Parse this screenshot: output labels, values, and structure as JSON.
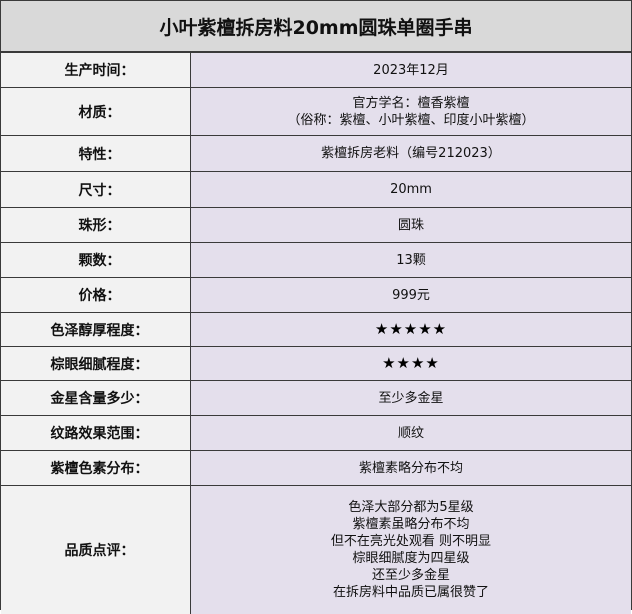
{
  "title": "小叶紫檀拆房料20mm圆珠单圈手串",
  "rows": [
    {
      "label": "生产时间：",
      "lines": [
        "2023年12月"
      ]
    },
    {
      "label": "材质：",
      "lines": [
        "官方学名：檀香紫檀",
        "（俗称：紫檀、小叶紫檀、印度小叶紫檀）"
      ]
    },
    {
      "label": "特性：",
      "lines": [
        "紫檀拆房老料（编号212023）"
      ]
    },
    {
      "label": "尺寸：",
      "lines": [
        "20mm"
      ]
    },
    {
      "label": "珠形：",
      "lines": [
        "圆珠"
      ]
    },
    {
      "label": "颗数：",
      "lines": [
        "13颗"
      ]
    },
    {
      "label": "价格：",
      "lines": [
        "999元"
      ]
    },
    {
      "label": "色泽醇厚程度：",
      "lines": [
        "★★★★★"
      ],
      "stars": 5
    },
    {
      "label": "棕眼细腻程度：",
      "lines": [
        "★★★★"
      ],
      "stars": 4
    },
    {
      "label": "金星含量多少：",
      "lines": [
        "至少多金星"
      ]
    },
    {
      "label": "纹路效果范围：",
      "lines": [
        "顺纹"
      ]
    },
    {
      "label": "紫檀色素分布：",
      "lines": [
        "紫檀素略分布不均"
      ]
    },
    {
      "label": "品质点评：",
      "lines": [
        "色泽大部分都为5星级",
        "紫檀素虽略分布不均",
        "但不在亮光处观看  则不明显",
        "棕眼细腻度为四星级",
        "还至少多金星",
        "在拆房料中品质已属很赞了"
      ]
    }
  ]
}
